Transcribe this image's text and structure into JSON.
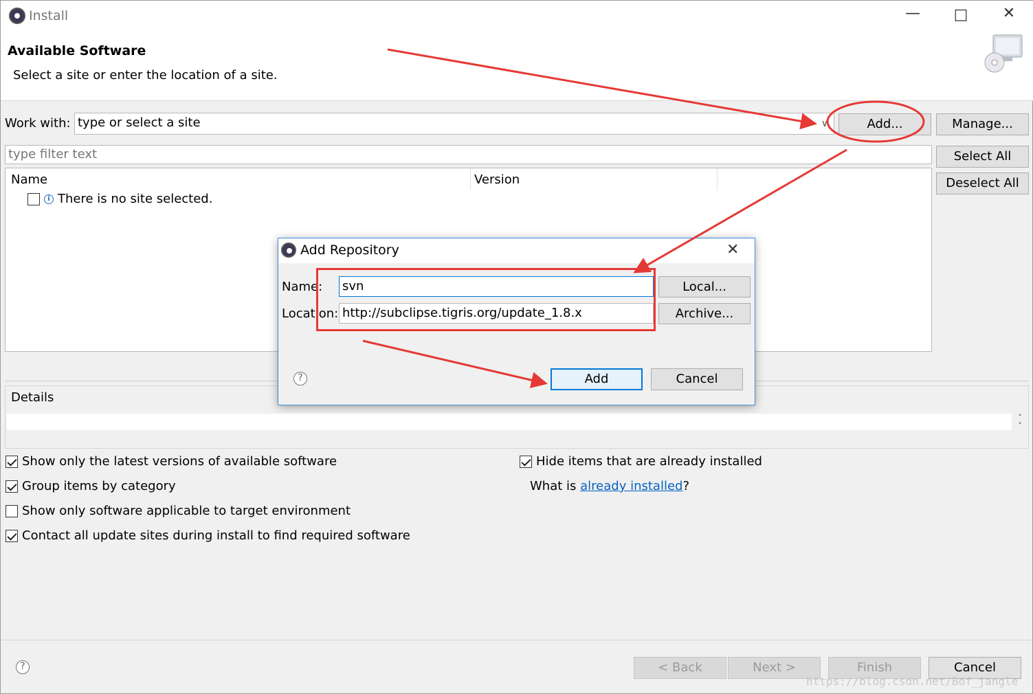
{
  "window": {
    "title": "Install"
  },
  "header": {
    "title": "Available Software",
    "subtitle": "Select a site or enter the location of a site."
  },
  "work_with": {
    "label": "Work with:",
    "value": "type or select a site",
    "add_label": "Add...",
    "manage_label": "Manage..."
  },
  "filter": {
    "placeholder": "type filter text"
  },
  "side_buttons": {
    "select_all": "Select All",
    "deselect_all": "Deselect All"
  },
  "table": {
    "columns": [
      "Name",
      "Version"
    ],
    "rows": [
      {
        "name": "There is no site selected.",
        "checked": false
      }
    ]
  },
  "details": {
    "label": "Details"
  },
  "options": {
    "left": [
      {
        "label": "Show only the latest versions of available software",
        "checked": true
      },
      {
        "label": "Group items by category",
        "checked": true
      },
      {
        "label": "Show only software applicable to target environment",
        "checked": false
      },
      {
        "label": "Contact all update sites during install to find required software",
        "checked": true
      }
    ],
    "right": [
      {
        "label": "Hide items that are already installed",
        "checked": true
      }
    ],
    "installed": {
      "prefix": "What is ",
      "link": "already installed",
      "suffix": "?"
    }
  },
  "footer": {
    "back": "< Back",
    "next": "Next >",
    "finish": "Finish",
    "cancel": "Cancel"
  },
  "dialog": {
    "title": "Add Repository",
    "name_label": "Name:",
    "name_value": "svn",
    "location_label": "Location:",
    "location_value": "http://subclipse.tigris.org/update_1.8.x",
    "local_label": "Local...",
    "archive_label": "Archive...",
    "add_label": "Add",
    "cancel_label": "Cancel"
  },
  "watermark": "https://blog.csdn.net/Bof_jangle",
  "colors": {
    "annotation": "#e53935",
    "accent": "#0078d7",
    "link": "#0563c1"
  }
}
